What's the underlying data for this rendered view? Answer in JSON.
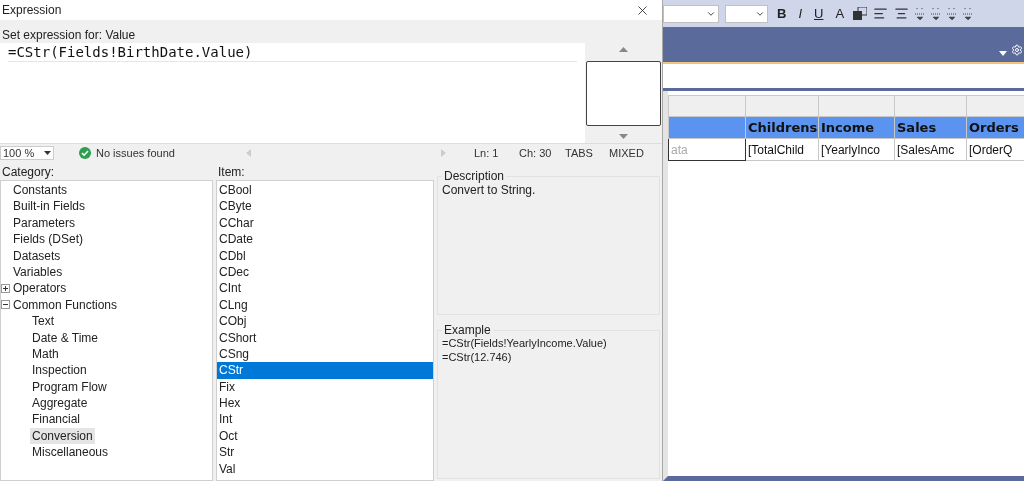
{
  "dialog": {
    "title": "Expression",
    "prompt": "Set expression for: Value",
    "expression": "=CStr(Fields!BirthDate.Value)",
    "status": {
      "zoom": "100 %",
      "issues": "No issues found",
      "line": "Ln: 1",
      "column": "Ch: 30",
      "indent": "TABS",
      "line_endings": "MIXED"
    },
    "category_label": "Category:",
    "categories": [
      {
        "label": "Constants",
        "selected": false
      },
      {
        "label": "Built-in Fields",
        "selected": false
      },
      {
        "label": "Parameters",
        "selected": false
      },
      {
        "label": "Fields (DSet)",
        "selected": false
      },
      {
        "label": "Datasets",
        "selected": false
      },
      {
        "label": "Variables",
        "selected": false
      },
      {
        "label": "Operators",
        "selected": false,
        "expanded": false
      },
      {
        "label": "Common Functions",
        "selected": false,
        "expanded": true,
        "children": [
          {
            "label": "Text",
            "selected": false
          },
          {
            "label": "Date & Time",
            "selected": false
          },
          {
            "label": "Math",
            "selected": false
          },
          {
            "label": "Inspection",
            "selected": false
          },
          {
            "label": "Program Flow",
            "selected": false
          },
          {
            "label": "Aggregate",
            "selected": false
          },
          {
            "label": "Financial",
            "selected": false
          },
          {
            "label": "Conversion",
            "selected": true
          },
          {
            "label": "Miscellaneous",
            "selected": false
          }
        ]
      }
    ],
    "item_label": "Item:",
    "items": [
      {
        "label": "CBool",
        "selected": false
      },
      {
        "label": "CByte",
        "selected": false
      },
      {
        "label": "CChar",
        "selected": false
      },
      {
        "label": "CDate",
        "selected": false
      },
      {
        "label": "CDbl",
        "selected": false
      },
      {
        "label": "CDec",
        "selected": false
      },
      {
        "label": "CInt",
        "selected": false
      },
      {
        "label": "CLng",
        "selected": false
      },
      {
        "label": "CObj",
        "selected": false
      },
      {
        "label": "CShort",
        "selected": false
      },
      {
        "label": "CSng",
        "selected": false
      },
      {
        "label": "CStr",
        "selected": true
      },
      {
        "label": "Fix",
        "selected": false
      },
      {
        "label": "Hex",
        "selected": false
      },
      {
        "label": "Int",
        "selected": false
      },
      {
        "label": "Oct",
        "selected": false
      },
      {
        "label": "Str",
        "selected": false
      },
      {
        "label": "Val",
        "selected": false
      }
    ],
    "description": {
      "title": "Description",
      "text": "Convert to String."
    },
    "example": {
      "title": "Example",
      "lines": [
        "=CStr(Fields!YearlyIncome.Value)",
        "=CStr(12.746)"
      ]
    }
  },
  "toolbar": {
    "format_buttons": [
      "B",
      "I",
      "U",
      "A"
    ]
  },
  "report_table": {
    "headers": [
      "Childrens",
      "Income",
      "Sales",
      "Orders"
    ],
    "row": [
      "ata",
      "[TotalChild",
      "[YearlyInco",
      "[SalesAmc",
      "[OrderQ"
    ]
  }
}
